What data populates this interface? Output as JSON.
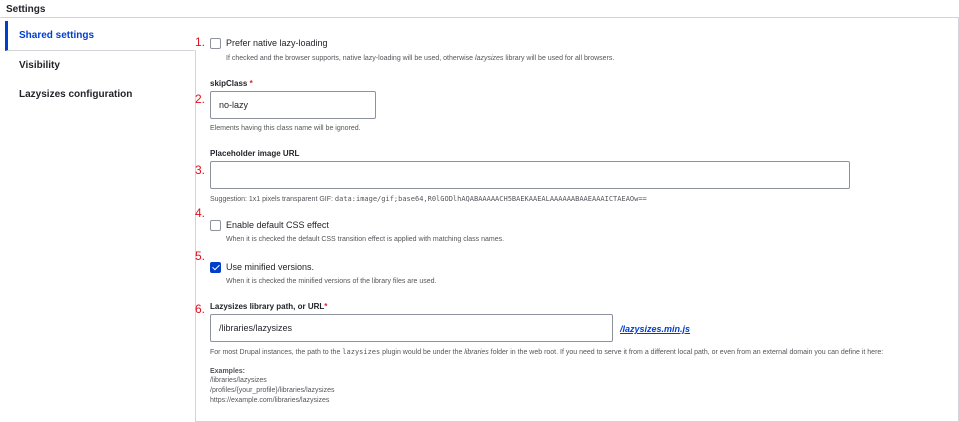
{
  "header": {
    "title": "Settings"
  },
  "tabs": [
    {
      "label": "Shared settings"
    },
    {
      "label": "Visibility"
    },
    {
      "label": "Lazysizes configuration"
    }
  ],
  "markers": [
    "1.",
    "2.",
    "3.",
    "4.",
    "5.",
    "6."
  ],
  "fields": {
    "native_lazy": {
      "label": "Prefer native lazy-loading",
      "checked": false,
      "desc_before": "If checked and the browser supports, native lazy-loading will be used, otherwise ",
      "desc_em": "lazysizes",
      "desc_after": " library will be used for all browsers."
    },
    "skip_class": {
      "label": "skipClass",
      "required": "*",
      "value": "no-lazy",
      "desc": "Elements having this class name will be ignored."
    },
    "placeholder": {
      "label": "Placeholder image URL",
      "value": "",
      "suggestion_prefix": "Suggestion: 1x1 pixels transparent GIF: ",
      "suggestion_code": "data:image/gif;base64,R0lGODlhAQABAAAAACH5BAEKAAEALAAAAAABAAEAAAICTAEAOw=="
    },
    "css_effect": {
      "label": "Enable default CSS effect",
      "checked": false,
      "desc": "When it is checked the default CSS transition effect is applied with matching class names."
    },
    "minified": {
      "label": "Use minified versions.",
      "checked": true,
      "desc": "When it is checked the minified versions of the library files are used."
    },
    "library_path": {
      "label": "Lazysizes library path, or URL",
      "required": "*",
      "value": "/libraries/lazysizes",
      "suffix_link": "/lazysizes.min.js",
      "desc_1": "For most Drupal instances, the path to the ",
      "desc_code": "lazysizes",
      "desc_2": " plugin would be under the ",
      "desc_em": "libraries",
      "desc_3": " folder in the web root. If you need to serve it from a different local path, or even from an external domain you can define it here:",
      "examples_title": "Examples:",
      "examples": [
        "/libraries/lazysizes",
        "/profiles/{your_profile}/libraries/lazysizes",
        "https://example.com/libraries/lazysizes"
      ]
    }
  },
  "colors": {
    "accent": "#003ecc",
    "marker": "#e10f1f",
    "required": "#dc2323"
  }
}
